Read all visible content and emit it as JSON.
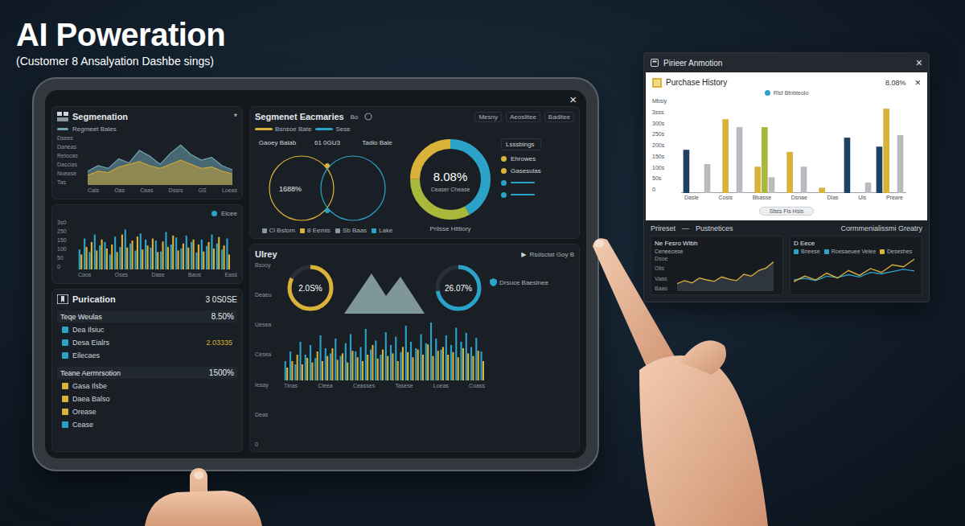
{
  "header": {
    "title": "AI Poweration",
    "subtitle": "(Customer 8 Ansalyation Dashbe sings)"
  },
  "tablet": {
    "close": "×",
    "segmentation": {
      "title": "Segmenation",
      "more": "*",
      "legend": "Regmeet Bales",
      "y_ticks": [
        "Dsees",
        "Daneas",
        "Retocas",
        "Daccias",
        "Noease",
        "Tas"
      ],
      "x_ticks": [
        "Cals",
        "Oas",
        "Ceas",
        "Dssrs",
        "GS",
        "Loeas"
      ],
      "max": 70,
      "series": [
        {
          "color": "#6fa3b3",
          "values": [
            20,
            28,
            24,
            38,
            32,
            50,
            42,
            30,
            46,
            58,
            44,
            36,
            40,
            28,
            22
          ]
        },
        {
          "color": "#c9a43a",
          "values": [
            14,
            20,
            18,
            26,
            30,
            34,
            28,
            24,
            30,
            36,
            30,
            24,
            26,
            20,
            16
          ]
        }
      ]
    },
    "volume": {
      "legend": "Elcee",
      "y_ticks": [
        "3s0",
        "250",
        "150",
        "100",
        "50",
        "0"
      ],
      "x_ticks": [
        "Caos",
        "Oses",
        "Dase",
        "Baos",
        "Eass"
      ],
      "max": 100,
      "series": [
        {
          "color": "#2ba3c8",
          "values": [
            40,
            62,
            35,
            70,
            48,
            55,
            30,
            66,
            45,
            80,
            52,
            38,
            72,
            60,
            44,
            58,
            36,
            75,
            50,
            64,
            42,
            68,
            55,
            34,
            60,
            47,
            70,
            52,
            40,
            62
          ]
        },
        {
          "color": "#d9b23a",
          "values": [
            30,
            45,
            55,
            38,
            60,
            42,
            50,
            35,
            70,
            44,
            58,
            66,
            40,
            48,
            62,
            35,
            56,
            45,
            68,
            38,
            52,
            44,
            60,
            50,
            36,
            55,
            42,
            65,
            48,
            30
          ]
        }
      ]
    },
    "purification": {
      "title": "Purication",
      "value": "3 0S0SE",
      "groups": [
        {
          "heading": "Teqe Weulas",
          "value": "8.50%",
          "items": [
            {
              "label": "Dea Ilsiuc",
              "color": "#2ba3c8"
            },
            {
              "label": "Desa Eialrs",
              "value": "2.03335",
              "color": "#2ba3c8"
            },
            {
              "label": "Eilecaes",
              "color": "#2ba3c8"
            }
          ]
        },
        {
          "heading": "Teane Aermrsotion",
          "value": "1500%",
          "items": [
            {
              "label": "Gasa Ilsbe",
              "color": "#d9b23a"
            },
            {
              "label": "Daea Balso",
              "color": "#d9b23a"
            },
            {
              "label": "Orease",
              "color": "#d9b23a"
            },
            {
              "label": "Cease",
              "color": "#2ba3c8"
            }
          ]
        }
      ]
    },
    "summaries": {
      "title": "Segmenet Eacmaries",
      "badge": "Bo",
      "tabs": [
        "Mesny",
        "Aeoslitee",
        "Badltee"
      ],
      "legend": [
        {
          "label": "Bsnsoe Bate",
          "color": "#d9b23a"
        },
        {
          "label": "Sese",
          "color": "#2ba3c8"
        }
      ],
      "venn": {
        "top_labels": [
          "Gaoey Balab",
          "61 0GU3",
          "Tadio Bale"
        ],
        "left_value": "1688%",
        "bottom_labels": [
          {
            "label": "Cl Bstom",
            "color": "#8c96a0"
          },
          {
            "label": "8 Eemis",
            "color": "#d9b23a"
          },
          {
            "label": "Sb Baas",
            "color": "#8c96a0"
          },
          {
            "label": "Lake",
            "color": "#2ba3c8"
          }
        ]
      },
      "donut": {
        "value": "8.08%",
        "label": "Ceaser Chease",
        "caption": "Prilsse Hittiory",
        "segments": [
          {
            "level": 0.42,
            "color": "#2ba3c8"
          },
          {
            "level": 0.33,
            "color": "#a8b83a"
          },
          {
            "level": 0.25,
            "color": "#d9b23a"
          }
        ]
      },
      "list": {
        "title": "Lsssbings",
        "items": [
          {
            "kind": "text",
            "label": "Ehrowes",
            "color": "#d9b23a"
          },
          {
            "kind": "text",
            "label": "Gasesulas",
            "color": "#d9b23a"
          },
          {
            "kind": "line",
            "color": "#2ba3c8"
          },
          {
            "kind": "line",
            "color": "#2ba3c8"
          }
        ]
      }
    },
    "survey": {
      "title": "Ulrey",
      "action_icon": "▶",
      "action": "Rsdsctat Goy B",
      "y_ticks": [
        "Bsooy",
        "Deaeu",
        "Uesea",
        "Cesea",
        "Iesay",
        "Deas",
        "0"
      ],
      "donuts": [
        {
          "value": "2.0S%",
          "level": 0.82,
          "color": "#d9b23a"
        },
        {
          "value": "26.07%",
          "level": 0.72,
          "color": "#2ba3c8"
        }
      ],
      "legend": [
        {
          "label": "Drsuce Baeslnee",
          "color": "#2ba3c8"
        }
      ],
      "x_ticks": [
        "Tlnas",
        "Cleea",
        "Ceasses",
        "Tasese",
        "Loeas",
        "Coass"
      ],
      "max": 100,
      "series": [
        {
          "color": "#2ba3c8",
          "values": [
            30,
            45,
            25,
            60,
            40,
            55,
            35,
            70,
            50,
            42,
            65,
            38,
            58,
            72,
            45,
            52,
            80,
            48,
            62,
            40,
            75,
            55,
            68,
            44,
            85,
            60,
            50,
            72,
            58,
            90,
            65,
            48,
            70,
            55,
            82,
            60,
            74,
            52,
            66,
            45
          ]
        },
        {
          "color": "#d9b23a",
          "values": [
            20,
            30,
            40,
            25,
            35,
            28,
            45,
            30,
            38,
            50,
            32,
            42,
            28,
            46,
            36,
            30,
            40,
            55,
            34,
            48,
            38,
            42,
            30,
            52,
            44,
            36,
            48,
            40,
            56,
            38,
            46,
            52,
            40,
            44,
            36,
            50,
            42,
            38,
            46,
            30
          ]
        }
      ]
    }
  },
  "window": {
    "title": "Pirieer Anmotion",
    "close": "×",
    "card": {
      "title": "Purchase History",
      "value": "8.08%",
      "close": "×",
      "legend": "Rlsf Bfnbteolo",
      "y_label": "Mbsiy",
      "y_ticks": [
        "3sss",
        "300s",
        "250s",
        "200s",
        "150s",
        "100s",
        "50s",
        "0"
      ],
      "x_ticks": [
        "Dasle",
        "Cosis",
        "Bbasse",
        "Dsnae",
        "Dlas",
        "Uls",
        "Preare"
      ],
      "max": 180,
      "series": [
        {
          "color": "#1f3f63",
          "values": [
            82,
            0,
            0,
            0,
            0,
            105,
            88
          ]
        },
        {
          "color": "#d9b23a",
          "values": [
            0,
            140,
            50,
            78,
            10,
            0,
            160
          ]
        },
        {
          "color": "#a8b83a",
          "values": [
            0,
            0,
            125,
            0,
            0,
            0,
            0
          ]
        },
        {
          "color": "#b8bcc0",
          "values": [
            55,
            125,
            30,
            50,
            0,
            20,
            110
          ]
        }
      ],
      "footer": "Sbss Fis Hsis"
    },
    "tabs": [
      "Prireset",
      "—",
      "Pustnetices"
    ],
    "tabs_right": "Cormmenialissmi Greatry",
    "trend_left": {
      "title": "Ne Fesro Wlbh",
      "subtitle": "Ceneecese",
      "y_ticks": [
        "Dsoe",
        "Olis",
        "Vaas",
        "Baas"
      ],
      "max": 90,
      "series": [
        {
          "color": "#d9b23a",
          "values": [
            20,
            28,
            22,
            35,
            30,
            26,
            38,
            32,
            28,
            45,
            40,
            55,
            62,
            78
          ]
        }
      ]
    },
    "trend_right": {
      "title": "D Eece",
      "max": 90,
      "legend": [
        {
          "label": "Bneese",
          "color": "#2ba3c8"
        },
        {
          "label": "Roesaeuee Velee",
          "color": "#2ba3c8"
        },
        {
          "label": "Deseshes",
          "color": "#d9b23a"
        }
      ],
      "series": [
        {
          "color": "#2ba3c8",
          "values": [
            30,
            34,
            28,
            40,
            36,
            44,
            38,
            50,
            46,
            52,
            58,
            54
          ]
        },
        {
          "color": "#d9b23a",
          "values": [
            25,
            40,
            30,
            48,
            35,
            55,
            42,
            60,
            50,
            70,
            65,
            85
          ]
        }
      ]
    }
  }
}
